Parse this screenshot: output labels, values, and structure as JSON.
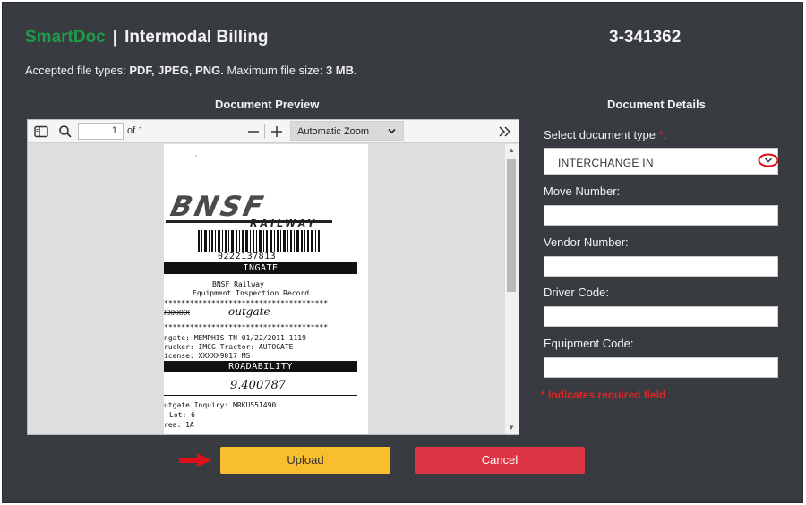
{
  "header": {
    "brand": "SmartDoc",
    "separator": "|",
    "title": "Intermodal Billing",
    "document_number": "3-341362"
  },
  "file_info": {
    "prefix": "Accepted file types: ",
    "types": "PDF, JPEG, PNG.",
    "size_prefix": " Maximum file size: ",
    "size": "3 MB."
  },
  "preview": {
    "title": "Document Preview",
    "toolbar": {
      "page_value": "1",
      "of_label": "of 1",
      "zoom": "Automatic Zoom"
    },
    "document": {
      "logo": "BNSF",
      "logo_sub": "RAILWAY",
      "barcode_number": "0222137813",
      "ingate_bar": "INGATE",
      "company": "BNSF Railway",
      "record": "Equipment Inspection Record",
      "stars": "**************************************",
      "outgate_label": "XXXXXX",
      "outgate_hand": "outgate",
      "line_ingate": "ngate: MEMPHIS   TN 01/22/2011 1119",
      "line_trucker": "rucker: IMCG        Tractor: AUTOGATE",
      "line_license": "icense: XXXXX9017        MS",
      "roadability_bar": "ROADABILITY",
      "hand_number": "9.400787",
      "line_inquiry": "utgate Inquiry: MRKU551490",
      "line_lot": "Lot:  6",
      "line_area": "rea:  1A"
    }
  },
  "details": {
    "title": "Document Details",
    "doc_type_label": "Select document type ",
    "required_mark": "*",
    "colon": ":",
    "doc_type_value": "INTERCHANGE IN",
    "move_label": "Move Number:",
    "vendor_label": "Vendor Number:",
    "driver_label": "Driver Code:",
    "equipment_label": "Equipment Code:",
    "required_note": "* Indicates required field"
  },
  "actions": {
    "upload": "Upload",
    "cancel": "Cancel"
  },
  "colors": {
    "background": "#383b40",
    "brand": "#1f9a48",
    "upload": "#f8be2e",
    "cancel": "#dc3545",
    "required": "#e02424"
  },
  "icons": [
    "sidebar-toggle-icon",
    "search-icon",
    "zoom-out-icon",
    "zoom-in-icon",
    "chevron-down-icon",
    "double-chevron-right-icon",
    "red-arrow-icon"
  ]
}
